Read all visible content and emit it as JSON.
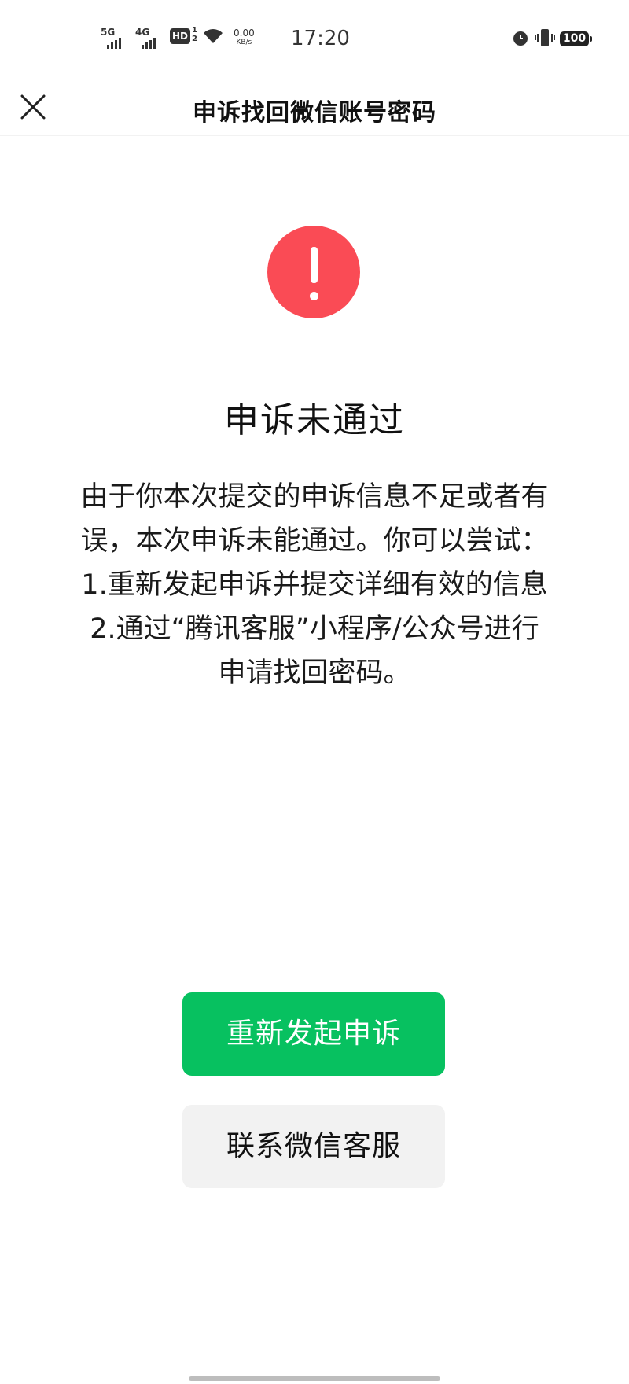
{
  "status_bar": {
    "signal1_label": "5G",
    "signal2_label": "4G",
    "hd_label": "HD",
    "hd_sim": "1",
    "hd_sim2": "2",
    "net_speed_value": "0.00",
    "net_speed_unit": "KB/s",
    "time": "17:20",
    "battery": "100",
    "icons": [
      "signal-icon",
      "wifi-icon",
      "alarm-icon",
      "vibrate-icon",
      "battery-icon"
    ]
  },
  "nav": {
    "title": "申诉找回微信账号密码",
    "close_icon": "close-icon"
  },
  "result": {
    "icon": "alert-icon",
    "icon_color": "#fa4b55",
    "title": "申诉未通过",
    "description_lines": [
      "由于你本次提交的申诉信息不足或者有",
      "误，本次申诉未能通过。你可以尝试：",
      "1.重新发起申诉并提交详细有效的信息",
      "2.通过“腾讯客服”小程序/公众号进行",
      "申请找回密码。"
    ]
  },
  "actions": {
    "primary_label": "重新发起申诉",
    "primary_color": "#07c160",
    "secondary_label": "联系微信客服",
    "secondary_color": "#f2f2f2"
  }
}
